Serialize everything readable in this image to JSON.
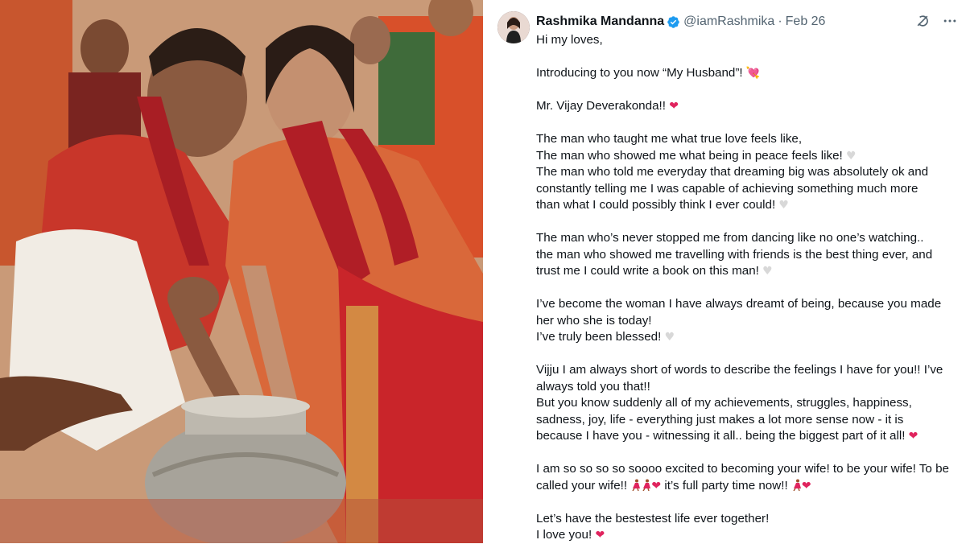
{
  "photo": {
    "alt_description": ""
  },
  "tweet": {
    "author_name": "Rashmika Mandanna",
    "handle": "@iamRashmika",
    "separator": "·",
    "date": "Feb 26",
    "lines": {
      "l1": "Hi my loves,",
      "l2a": "Introducing to you now “My Husband”!",
      "l2b": "💘",
      "l3a": "Mr. Vijay Deverakonda!!",
      "l4a": "The man who taught me what true love feels like,",
      "l5a": "The man who showed me what being in peace feels like!",
      "l6a": "The man who told me everyday that dreaming big was absolutely ok and",
      "l6b": "constantly telling me I was capable of achieving something much more",
      "l6c": "than what I could possibly think I ever could!",
      "l7a": "The man who’s never stopped me from dancing like no one’s watching..",
      "l7b": "the man who showed me travelling with friends is the best thing ever, and",
      "l7c": "trust me I could write a book on this man!",
      "l8a": "I’ve become the woman I have always dreamt of being, because you made",
      "l8b": "her who she is today!",
      "l8c": "I’ve truly been blessed!",
      "l9a": "Vijju I am always short of words to describe the feelings I have for you!! I’ve",
      "l9b": "always told you that!!",
      "l9c": "But you know suddenly all of my achievements, struggles, happiness,",
      "l9d": "sadness, joy, life - everything just makes a lot more sense now - it is",
      "l9e": "because I have you - witnessing it all.. being the biggest part of it all!",
      "l10a": "I am so so so so soooo excited to becoming your wife! to be your wife! To be",
      "l10b": "called your wife!!",
      "l10c": "it’s full party time now!!",
      "l11a": "Let’s have the bestestest life ever together!",
      "l11b": "I love you!"
    },
    "heart_red": "❤",
    "heart_white": "♥"
  },
  "colors": {
    "text": "#0f1419",
    "muted": "#536471",
    "verified_blue": "#1d9bf0",
    "red_heart": "#e0245e"
  },
  "icons": [
    "verified-badge-icon",
    "grok-icon",
    "more-icon",
    "red-heart-icon",
    "white-heart-icon",
    "heart-with-arrow-icon",
    "dancer-icon"
  ]
}
